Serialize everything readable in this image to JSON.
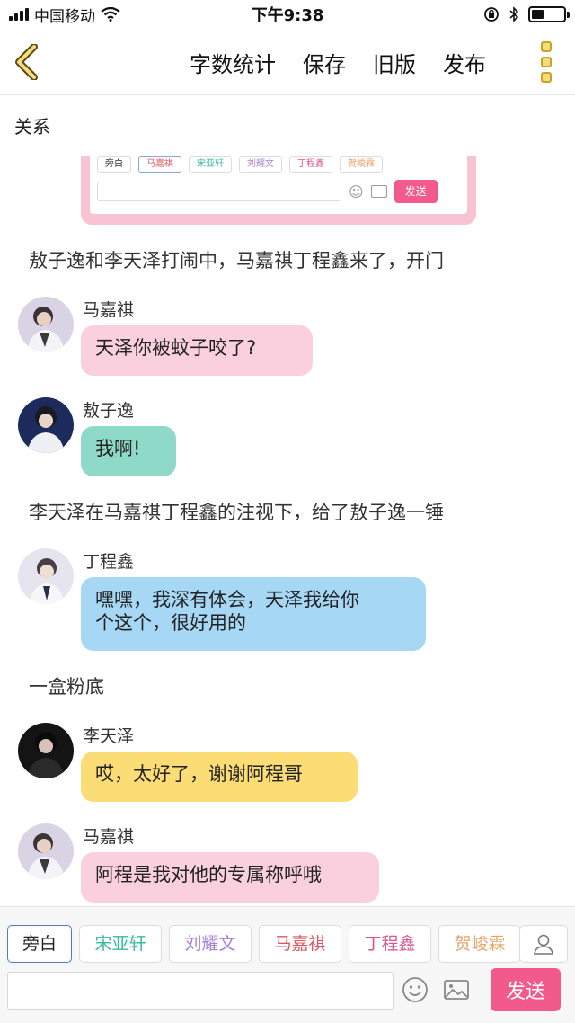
{
  "status_bar": {
    "carrier": "中国移动",
    "time": "下午9:38"
  },
  "nav": {
    "actions": [
      "字数统计",
      "保存",
      "旧版",
      "发布"
    ]
  },
  "category": "关系",
  "embedded_image": {
    "chips": [
      "旁白",
      "马嘉祺",
      "宋亚轩",
      "刘耀文",
      "丁程鑫",
      "贺峻霖"
    ],
    "send_label": "发送"
  },
  "story": [
    {
      "type": "narration",
      "text": "敖子逸和李天泽打闹中，马嘉祺丁程鑫来了，开门"
    },
    {
      "type": "message",
      "speaker": "马嘉祺",
      "text": "天泽你被蚊子咬了?",
      "color": "#fbd0de"
    },
    {
      "type": "message",
      "speaker": "敖子逸",
      "text": "我啊!",
      "color": "#8ed9c8"
    },
    {
      "type": "narration",
      "text": "李天泽在马嘉祺丁程鑫的注视下，给了敖子逸一锤"
    },
    {
      "type": "message",
      "speaker": "丁程鑫",
      "text_lines": [
        "嘿嘿，我深有体会，天泽我给你",
        "个这个，很好用的"
      ],
      "color": "#a6d8f6"
    },
    {
      "type": "narration",
      "text": "一盒粉底"
    },
    {
      "type": "message",
      "speaker": "李天泽",
      "text": "哎，太好了，谢谢阿程哥",
      "color": "#fbdc75"
    },
    {
      "type": "message",
      "speaker": "马嘉祺",
      "text": "阿程是我对他的专属称呼哦",
      "color": "#fbd0de"
    }
  ],
  "toolbar": {
    "characters": [
      {
        "label": "旁白",
        "color": "#222222"
      },
      {
        "label": "宋亚轩",
        "color": "#37b8a2"
      },
      {
        "label": "刘耀文",
        "color": "#a87ed6"
      },
      {
        "label": "马嘉祺",
        "color": "#e0555f"
      },
      {
        "label": "丁程鑫",
        "color": "#d6558c"
      },
      {
        "label": "贺峻霖",
        "color": "#e6a46a"
      }
    ],
    "input_placeholder": "",
    "send_label": "发送"
  },
  "colors": {
    "accent_pink": "#f25a8c",
    "selected_border": "#4a7bd1"
  }
}
